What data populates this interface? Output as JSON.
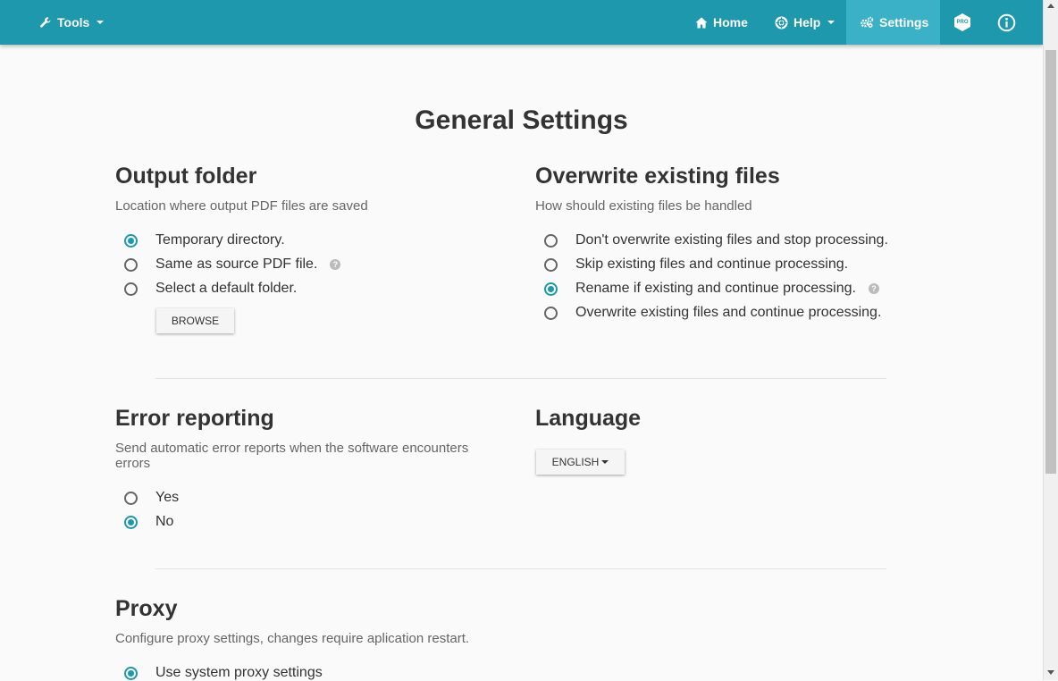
{
  "navbar": {
    "tools_label": "Tools",
    "home_label": "Home",
    "help_label": "Help",
    "settings_label": "Settings",
    "pro_badge": "PRO",
    "icons": {
      "tools": "wrench-icon",
      "home": "home-icon",
      "help": "lifebuoy-icon",
      "settings": "gears-icon",
      "pro": "pro-hexagon-icon",
      "info": "info-icon"
    },
    "accent_color": "#1d98ad",
    "active_color": "#3bb1c7"
  },
  "page": {
    "title": "General Settings"
  },
  "output_folder": {
    "title": "Output folder",
    "description": "Location where output PDF files are saved",
    "options": [
      {
        "label": "Temporary directory.",
        "selected": true
      },
      {
        "label": "Same as source PDF file.",
        "selected": false
      },
      {
        "label": "Select a default folder.",
        "selected": false
      }
    ],
    "browse_label": "Browse"
  },
  "overwrite": {
    "title": "Overwrite existing files",
    "description": "How should existing files be handled",
    "options": [
      {
        "label": "Don't overwrite existing files and stop processing.",
        "selected": false
      },
      {
        "label": "Skip existing files and continue processing.",
        "selected": false
      },
      {
        "label": "Rename if existing and continue processing.",
        "selected": true
      },
      {
        "label": "Overwrite existing files and continue processing.",
        "selected": false
      }
    ]
  },
  "error_reporting": {
    "title": "Error reporting",
    "description": "Send automatic error reports when the software encounters errors",
    "options": [
      {
        "label": "Yes",
        "selected": false
      },
      {
        "label": "No",
        "selected": true
      }
    ]
  },
  "language": {
    "title": "Language",
    "selected": "English"
  },
  "proxy": {
    "title": "Proxy",
    "description": "Configure proxy settings, changes require aplication restart.",
    "options": [
      {
        "label": "Use system proxy settings",
        "selected": true
      }
    ]
  },
  "help_glyph": "?"
}
